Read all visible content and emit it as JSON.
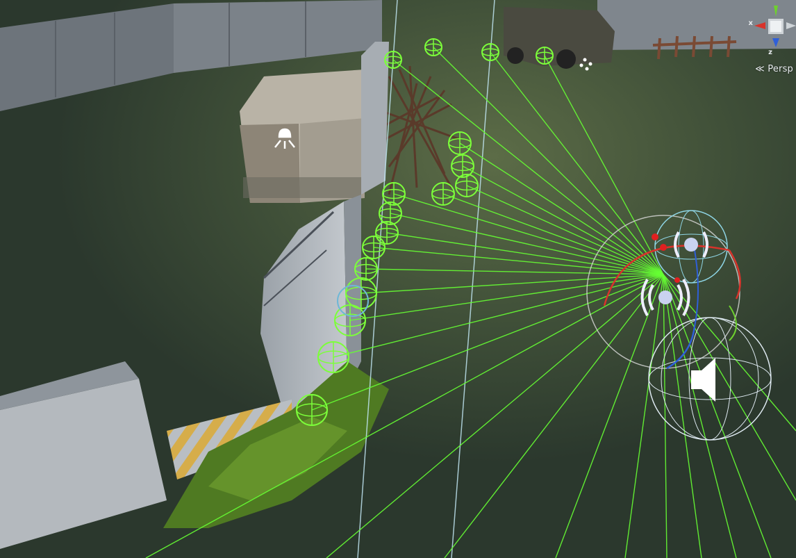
{
  "view": {
    "mode": "scene-view",
    "projection_label": "Persp",
    "axis_labels": {
      "x": "x",
      "z": "z"
    }
  },
  "colors": {
    "ground": "#2f3d31",
    "ground_lit": "#4a5a3e",
    "wall": "#b7bcc2",
    "wall_dark": "#7a8189",
    "grass": "#4f7a22",
    "ray": "#66ff33",
    "probe": "#7cff3a",
    "sphere_outline": "#d9e7f0",
    "guide_line": "#bfe4f0",
    "axis_red": "#d8332b",
    "axis_blue": "#2f5fd8",
    "axis_green": "#6ed12e",
    "hazard_yellow": "#d9b24a"
  },
  "icons": [
    "light-icon",
    "audio-source-icon",
    "audio-listener-icon",
    "particle-icon",
    "scene-axis-gizmo-icon"
  ],
  "scene": {
    "probe_count": 17,
    "ray_count": 26
  }
}
